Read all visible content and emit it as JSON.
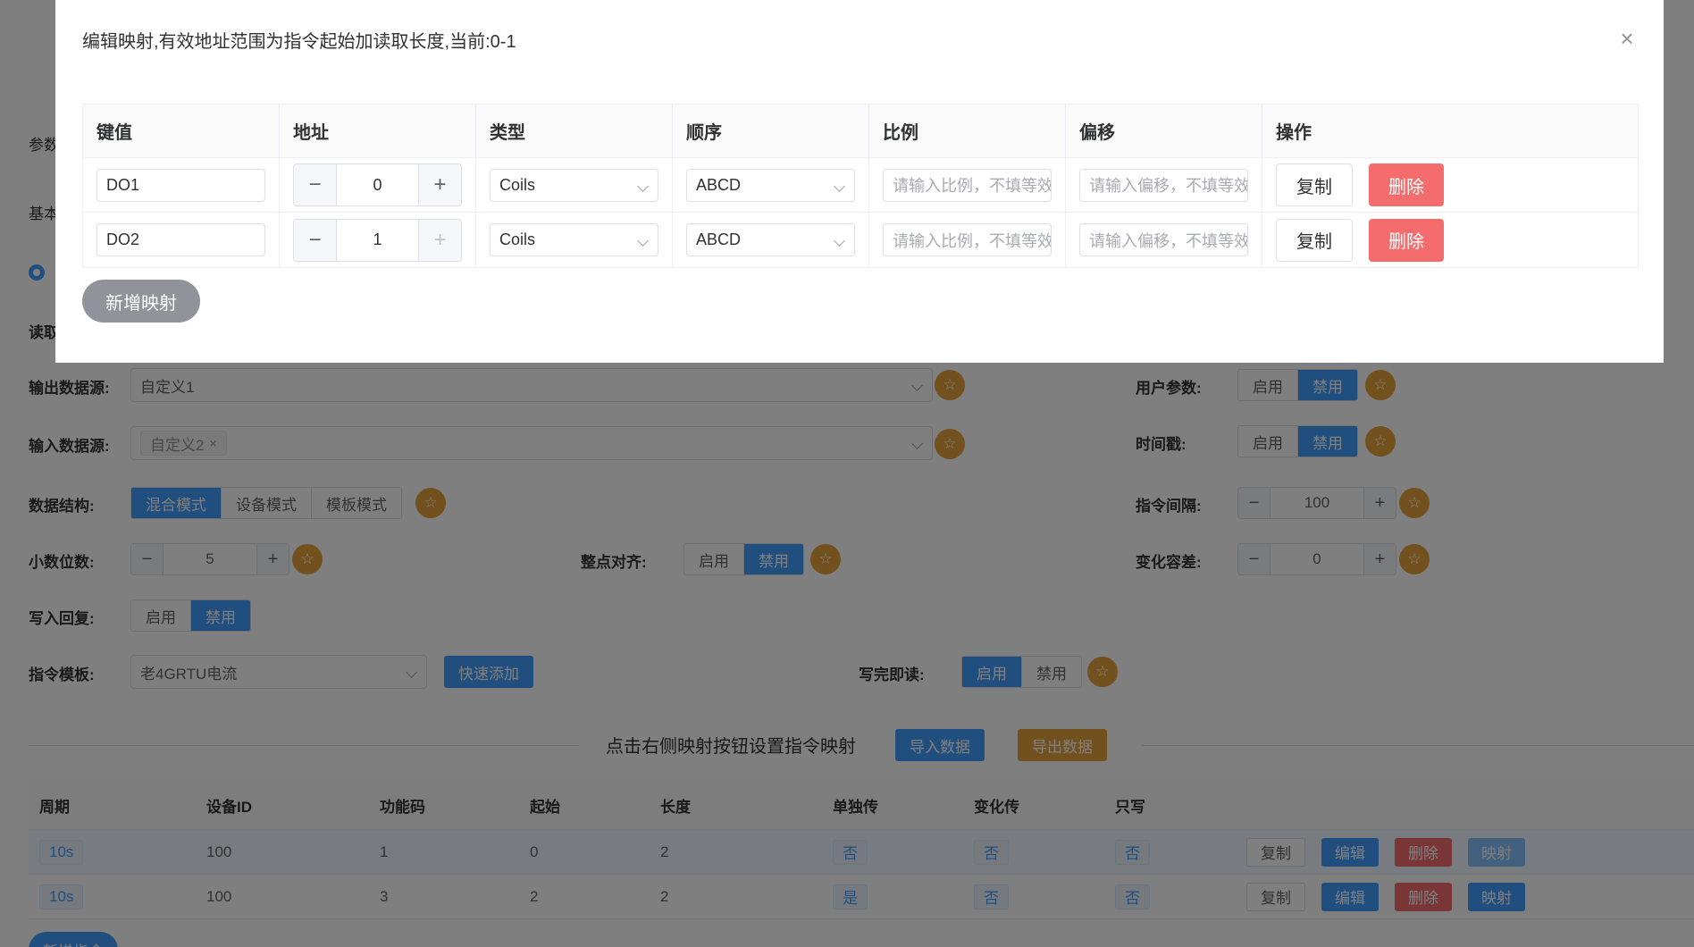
{
  "background": {
    "left_labels": {
      "param_tab": "参数",
      "basic_tab": "基本",
      "read_label": "读取"
    },
    "fields": {
      "output_source": {
        "label": "输出数据源:",
        "value": "自定义1"
      },
      "input_source": {
        "label": "输入数据源:",
        "tag": "自定义2",
        "tag_close": "×"
      },
      "data_structure": {
        "label": "数据结构:",
        "options": [
          "混合模式",
          "设备模式",
          "模板模式"
        ],
        "selected": "混合模式"
      },
      "decimals": {
        "label": "小数位数:",
        "value": "5",
        "minus": "−",
        "plus": "+"
      },
      "hour_align": {
        "label": "整点对齐:",
        "options": [
          "启用",
          "禁用"
        ],
        "selected": "禁用"
      },
      "write_reply": {
        "label": "写入回复:",
        "options": [
          "启用",
          "禁用"
        ],
        "selected": "禁用"
      },
      "cmd_template": {
        "label": "指令模板:",
        "value": "老4GRTU电流",
        "quick_add": "快速添加"
      },
      "read_after_write": {
        "label": "写完即读:",
        "options": [
          "启用",
          "禁用"
        ],
        "selected": "启用"
      },
      "user_params": {
        "label": "用户参数:",
        "options": [
          "启用",
          "禁用"
        ],
        "selected": "禁用"
      },
      "timestamp": {
        "label": "时间戳:",
        "options": [
          "启用",
          "禁用"
        ],
        "selected": "禁用"
      },
      "cmd_interval": {
        "label": "指令间隔:",
        "value": "100",
        "minus": "−",
        "plus": "+"
      },
      "change_tolerance": {
        "label": "变化容差:",
        "value": "0",
        "minus": "−",
        "plus": "+"
      }
    },
    "star_icon": "☆",
    "mapping_hint": "点击右侧映射按钮设置指令映射",
    "import_btn": "导入数据",
    "export_btn": "导出数据",
    "cmd_table": {
      "columns": [
        "周期",
        "设备ID",
        "功能码",
        "起始",
        "长度",
        "单独传",
        "变化传",
        "只写"
      ],
      "rows": [
        {
          "period": "10s",
          "device_id": "100",
          "func_code": "1",
          "start": "0",
          "length": "2",
          "single": "否",
          "change": "否",
          "write_only": "否"
        },
        {
          "period": "10s",
          "device_id": "100",
          "func_code": "3",
          "start": "2",
          "length": "2",
          "single": "是",
          "change": "否",
          "write_only": "否"
        }
      ],
      "actions": {
        "copy": "复制",
        "edit": "编辑",
        "delete": "删除",
        "map": "映射"
      }
    },
    "add_cmd_btn": "新增指令"
  },
  "dialog": {
    "title": "编辑映射,有效地址范围为指令起始加读取长度,当前:0-1",
    "close_icon": "×",
    "columns": [
      "键值",
      "地址",
      "类型",
      "顺序",
      "比例",
      "偏移",
      "操作"
    ],
    "rows": [
      {
        "key": "DO1",
        "address": "0",
        "type": "Coils",
        "order": "ABCD",
        "ratio_placeholder": "请输入比例，不填等效",
        "offset_placeholder": "请输入偏移，不填等效",
        "copy": "复制",
        "delete": "删除"
      },
      {
        "key": "DO2",
        "address": "1",
        "type": "Coils",
        "order": "ABCD",
        "ratio_placeholder": "请输入比例，不填等效",
        "offset_placeholder": "请输入偏移，不填等效",
        "copy": "复制",
        "delete": "删除"
      }
    ],
    "minus": "−",
    "plus": "+",
    "add_mapping": "新增映射"
  }
}
